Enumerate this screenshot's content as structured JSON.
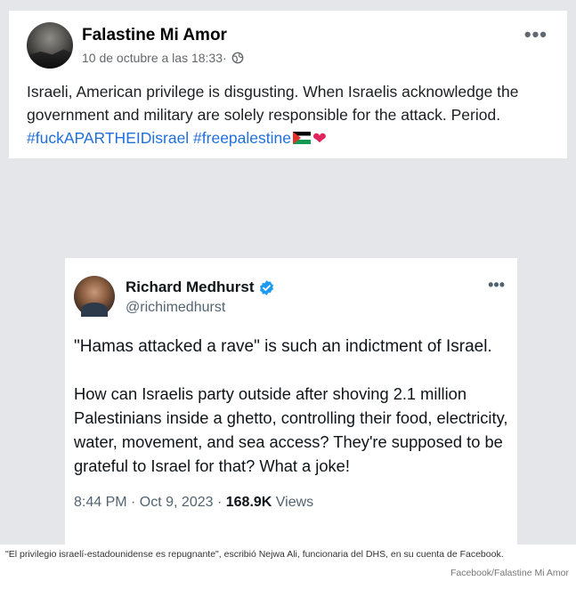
{
  "post": {
    "page_name": "Falastine Mi Amor",
    "timestamp": "10 de octubre a las 18:33",
    "separator": " · ",
    "audience_icon": "globe-icon",
    "more_icon": "more-horizontal-icon",
    "text": "Israeli, American privilege is disgusting. When Israelis acknowledge the government and military are solely responsible for the attack. Period.",
    "hashtags": "#fuckAPARTHEIDisrael #freepalestine",
    "emojis": [
      "palestine-flag-icon",
      "red-heart-icon"
    ]
  },
  "tweet": {
    "name": "Richard Medhurst",
    "handle": "@richimedhurst",
    "verified_icon": "verified-badge-icon",
    "paragraph1": "\"Hamas attacked a rave\" is such an indictment of Israel.",
    "paragraph2": "How can Israelis party outside after shoving 2.1 million Palestinians inside a ghetto, controlling their food, electricity, water, movement, and sea access? They're supposed to be grateful to Israel for that? What a joke!",
    "time": "8:44 PM · Oct 9, 2023 · ",
    "views_count": "168.9K",
    "views_label": " Views"
  },
  "caption": "\"El privilegio israelí-estadounidense es repugnante\", escribió Nejwa Ali, funcionaria del DHS, en su cuenta de Facebook.",
  "credit": "Facebook/Falastine Mi Amor",
  "colors": {
    "hashtag": "#216fdb",
    "verified": "#1d9bf0",
    "background": "#e4e6e9"
  }
}
